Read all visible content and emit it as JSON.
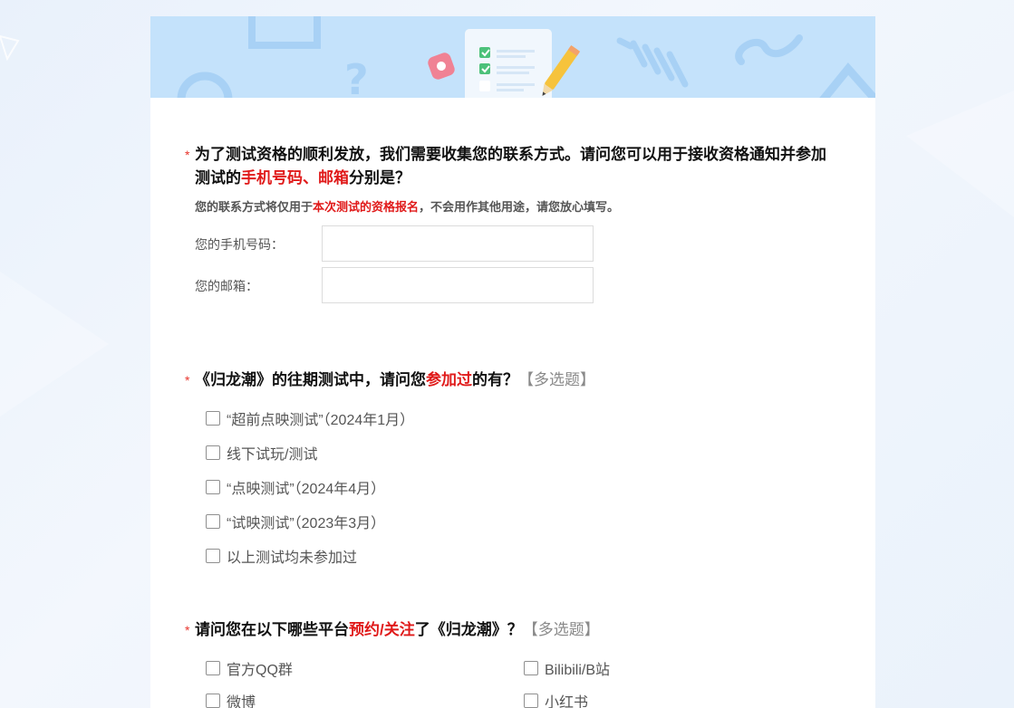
{
  "q1": {
    "required_mark": "*",
    "title_part1": "为了测试资格的顺利发放，我们需要收集您的联系方式。请问您可以用于接收资格通知并参加",
    "title_part2": "测试的",
    "title_highlight": "手机号码、邮箱",
    "title_part3": "分别是？",
    "desc_part1": "您的联系方式将仅用于",
    "desc_highlight": "本次测试的资格报名",
    "desc_part2": "，不会用作其他用途，请您放心填写。",
    "phone_label": "您的手机号码：",
    "phone_value": "",
    "email_label": "您的邮箱：",
    "email_value": ""
  },
  "q2": {
    "required_mark": "*",
    "title_part1": "《归龙潮》的往期测试中，请问您",
    "title_highlight": "参加过",
    "title_part2": "的有？",
    "tag": "【多选题】",
    "options": [
      "“超前点映测试”（2024年1月）",
      "线下试玩/测试",
      "“点映测试”（2024年4月）",
      "“试映测试”（2023年3月）",
      "以上测试均未参加过"
    ]
  },
  "q3": {
    "required_mark": "*",
    "title_part1": "请问您在以下哪些平台",
    "title_highlight": "预约/关注",
    "title_part2": "了《归龙潮》？",
    "tag": "【多选题】",
    "options": [
      "官方QQ群",
      "Bilibili/B站",
      "微博",
      "小红书"
    ]
  },
  "colors": {
    "required": "#e8342c",
    "highlight": "#e01a1a",
    "banner": "#c4e2fb"
  }
}
